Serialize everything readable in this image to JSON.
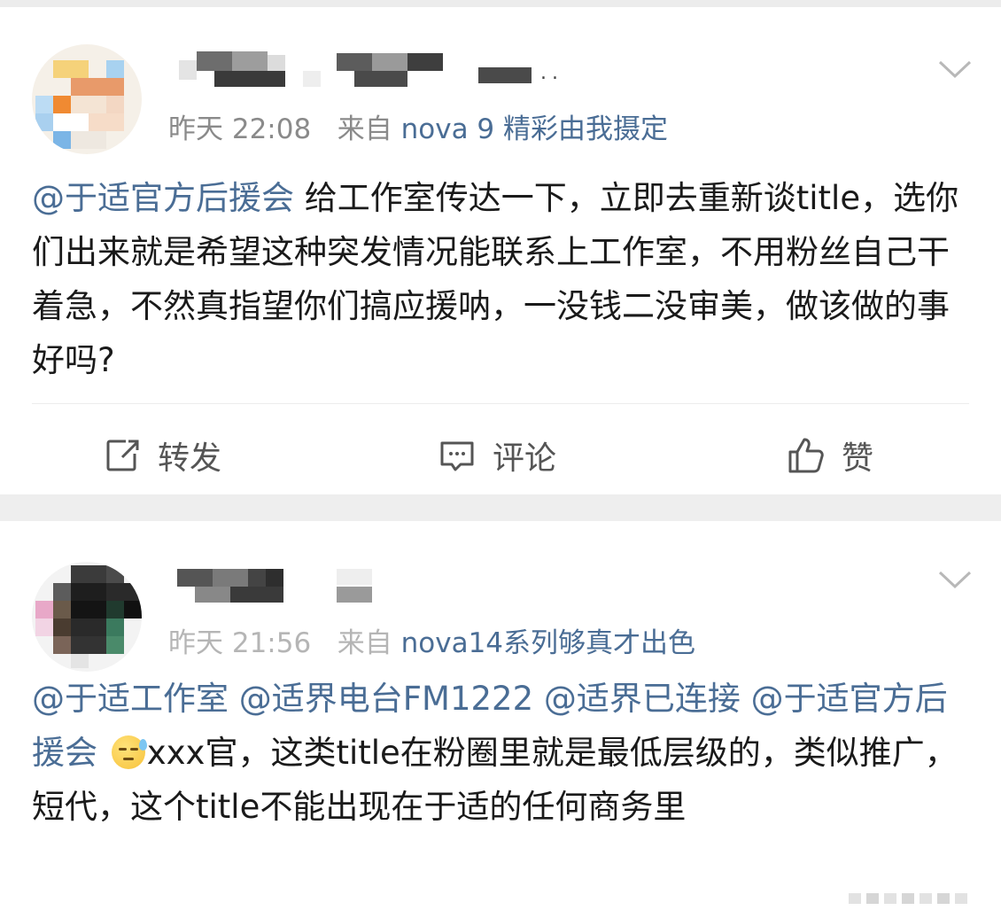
{
  "posts": [
    {
      "time": "昨天 22:08",
      "source_prefix": "来自",
      "source": "nova 9 精彩由我摄定",
      "name_suffix": "..",
      "content_mention": "@于适官方后援会",
      "content_text": " 给工作室传达一下，立即去重新谈title，选你们出来就是希望这种突发情况能联系上工作室，不用粉丝自己干着急，不然真指望你们搞应援呐，一没钱二没审美，做该做的事好吗?",
      "actions": {
        "repost": "转发",
        "comment": "评论",
        "like": "赞"
      }
    },
    {
      "time": "昨天 21:56",
      "source_prefix": "来自",
      "source": "nova14系列够真才出色",
      "mentions": [
        "@于适工作室",
        "@适界电台FM1222",
        "@适界已连接",
        "@于适官方后援会"
      ],
      "emoji": "sweat-face-emoji",
      "content_text": "xxx官，这类title在粉圈里就是最低层级的，类似推广，短代，这个title不能出现在于适的任何商务里"
    }
  ],
  "colors": {
    "link": "#4a6d95",
    "meta": "#8a8a8a",
    "text": "#1a1a1a",
    "background": "#eeeeee"
  }
}
